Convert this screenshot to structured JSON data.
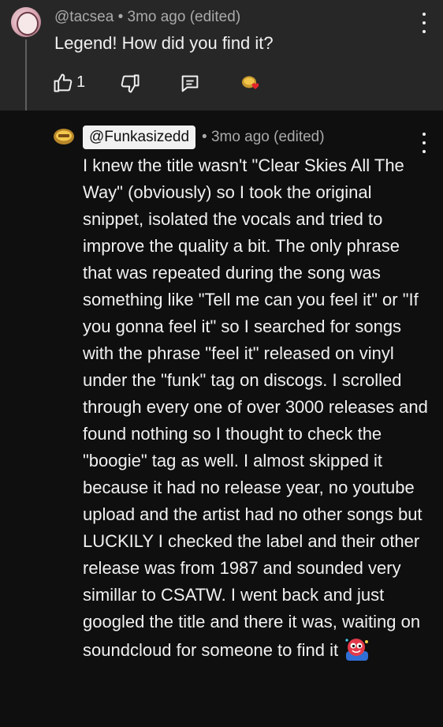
{
  "top_comment": {
    "author": "@tacsea",
    "separator": "•",
    "time": "3mo ago (edited)",
    "text": "Legend! How did you find it?",
    "like_count": "1",
    "icons": [
      "thumbs-up-icon",
      "thumbs-down-icon",
      "reply-icon",
      "creator-heart-icon",
      "more-vert-icon"
    ]
  },
  "reply": {
    "author": "@Funkasizedd",
    "separator": "•",
    "time": "3mo ago (edited)",
    "text": "I knew the title wasn't \"Clear Skies All The Way\" (obviously) so I took the original snippet, isolated the vocals and tried to improve the quality a bit. The only phrase that was repeated during the song was something like \"Tell me can you feel it\" or \"If you gonna feel it\" so I searched for songs with the phrase \"feel it\" released on vinyl under the \"funk\" tag on discogs. I scrolled through every one of over 3000 releases and found nothing so I thought to check the \"boogie\" tag as well. I almost skipped it because it had no release year, no youtube upload and the artist had no other songs but LUCKILY I checked the label and their other release was from 1987 and sounded very simillar to CSATW. I went back and just googled the title and there it was, waiting on soundcloud for someone to find it",
    "icons": [
      "funk-logo-avatar-icon",
      "more-vert-icon",
      "party-emoji-icon"
    ]
  },
  "colors": {
    "top_background": "#272727",
    "page_background": "#0f0f0f",
    "secondary_text": "#aaaaaa",
    "primary_text": "#f1f1f1",
    "heart": "#e3242b"
  }
}
